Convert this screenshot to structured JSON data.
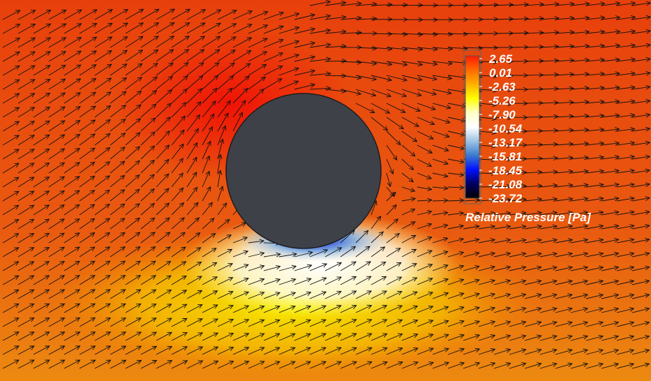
{
  "chart_data": {
    "type": "heatmap",
    "description_kind": "pressure contour with velocity vectors around cylinder",
    "colorbar": {
      "title": "Relative Pressure [Pa]",
      "ticks": [
        "2.65",
        "0.01",
        "-2.63",
        "-5.26",
        "-7.90",
        "-10.54",
        "-13.17",
        "-15.81",
        "-18.45",
        "-21.08",
        "-23.72"
      ],
      "range": [
        -23.72,
        2.65
      ],
      "colors": [
        "#ff1a00",
        "#ff6a00",
        "#ffb000",
        "#ffff00",
        "#ffffc8",
        "#ffffff",
        "#9cc4e4",
        "#3a7ad0",
        "#0010ff",
        "#000060",
        "#000000"
      ]
    },
    "colors": {
      "cylinder": "#3f4149",
      "background": "#e64a0e",
      "stagnation": "#ee1c08",
      "suction": "#f2e600",
      "wake": "#ffffff",
      "minimum": "#0018e0"
    }
  }
}
